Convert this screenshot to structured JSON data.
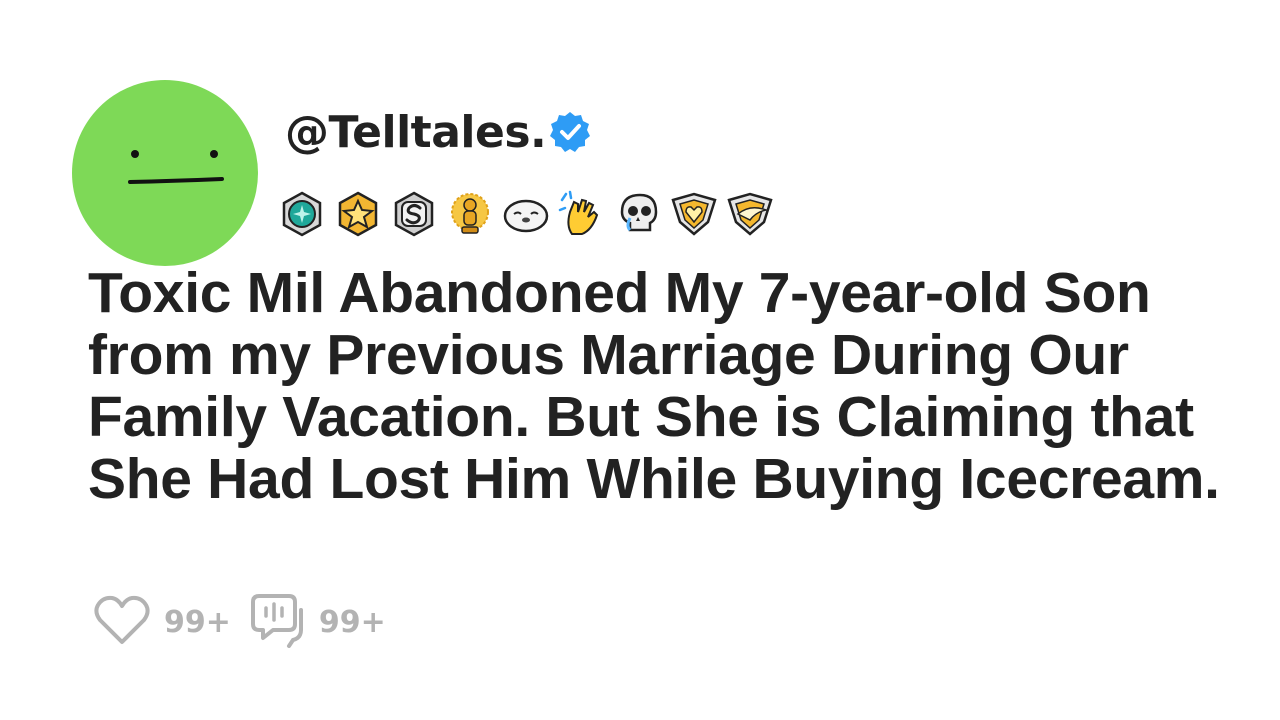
{
  "profile": {
    "username": "@Telltales.",
    "avatar_color": "#7ed957",
    "verified_color": "#2e9cf5"
  },
  "badges": [
    "teal-medal-icon",
    "gold-star-medal-icon",
    "silver-s-coin-icon",
    "gold-trophy-mascot-icon",
    "seal-icon",
    "clapping-hands-icon",
    "crying-skull-icon",
    "gold-heart-shield-icon",
    "gold-wing-shield-icon"
  ],
  "post": {
    "title": "Toxic Mil Abandoned My 7-year-old Son from my Previous Marriage During Our Family Vacation. But She is Claiming that She Had Lost Him While Buying Icecream."
  },
  "stats": {
    "likes": "99+",
    "comments": "99+",
    "icon_color": "#b3b3b3"
  }
}
